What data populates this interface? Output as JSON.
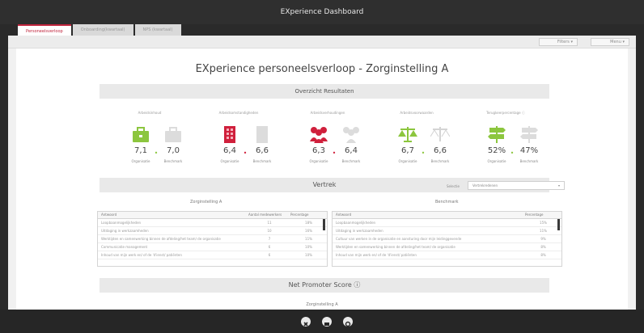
{
  "window": {
    "title": "EXperience Dashboard"
  },
  "tabs": [
    {
      "label": "Personeelsverloop",
      "active": true
    },
    {
      "label": "Onboarding(kwartaal)",
      "active": false
    },
    {
      "label": "NPS (kwartaal)",
      "active": false
    }
  ],
  "topbar": {
    "filters_label": "Filters ▾",
    "menu_label": "Menu ▾"
  },
  "page_title": "EXperience personeelsverloop - Zorginstelling A",
  "overview": {
    "header": "Overzicht Resultaten",
    "kpis": [
      {
        "label": "Arbeidsinhoud",
        "org_value": "7,1",
        "bench_value": "7,0",
        "icon": "briefcase-icon",
        "color": "#8cc63e",
        "dot": "#8cc63e"
      },
      {
        "label": "Arbeidsomstandigheden",
        "org_value": "6,4",
        "bench_value": "6,6",
        "icon": "building-icon",
        "color": "#d0203c",
        "dot": "#d0203c"
      },
      {
        "label": "Arbeidsverhoudingen",
        "org_value": "6,3",
        "bench_value": "6,4",
        "icon": "people-icon",
        "color": "#d0203c",
        "dot": "#d0203c"
      },
      {
        "label": "Arbeidsvoorwaarden",
        "org_value": "6,7",
        "bench_value": "6,6",
        "icon": "scales-icon",
        "color": "#8cc63e",
        "dot": "#8cc63e"
      },
      {
        "label": "Terugkeerpercentage ⓘ",
        "org_value": "52%",
        "bench_value": "47%",
        "icon": "signpost-icon",
        "color": "#8cc63e",
        "dot": "#8cc63e"
      }
    ],
    "org_caption": "Organisatie",
    "bench_caption": "Benchmark"
  },
  "vertrek": {
    "header": "Vertrek",
    "select_label": "Selectie",
    "select_value": "Vertrekredenen",
    "left_title": "Zorginstelling A",
    "right_title": "Benchmark",
    "left_table": {
      "headers": [
        "Antwoord",
        "Aantal medewerkers",
        "Percentage"
      ],
      "rows": [
        [
          "Loopbaanmogelijkheden",
          "11",
          "18%"
        ],
        [
          "Uitdaging in werkzaamheden",
          "10",
          "16%"
        ],
        [
          "Werktijden en samenwerking binnen de afdeling/het team/ de organisatie",
          "7",
          "11%"
        ],
        [
          "Communicatie management",
          "6",
          "10%"
        ],
        [
          "Inhoud van mijn werk en/ of de 'd'ienst/ patiënten",
          "6",
          "10%"
        ]
      ]
    },
    "right_table": {
      "headers": [
        "Antwoord",
        "Percentage"
      ],
      "rows": [
        [
          "Loopbaanmogelijkheden",
          "15%"
        ],
        [
          "Uitdaging in werkzaamheden",
          "11%"
        ],
        [
          "Cultuur van werken in de organisatie en aansturing door mijn leidinggevende",
          "9%"
        ],
        [
          "Werktijden en samenwerking binnen de afdeling/het team/ de organisatie",
          "8%"
        ],
        [
          "Inhoud van mijn werk en/ of de 'd'ienst/ patiënten",
          "8%"
        ]
      ]
    }
  },
  "nps": {
    "header": "Net Promoter Score ⓘ",
    "sub_title": "Zorginstelling A"
  },
  "footer": {
    "buttons": [
      "close-icon",
      "fullscreen-icon",
      "settings-icon"
    ]
  }
}
